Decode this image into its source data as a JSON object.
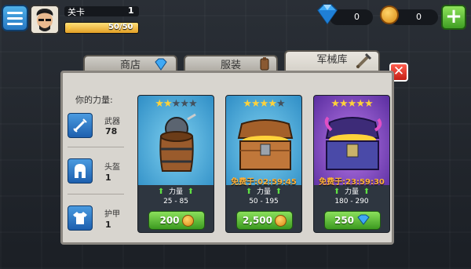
{
  "header": {
    "level_label": "关卡",
    "level_value": "1",
    "xp_text": "50/50",
    "xp_fraction": 1.0,
    "gems": "0",
    "coins": "0"
  },
  "tabs": [
    {
      "label": "商店",
      "icon": "diamond-icon"
    },
    {
      "label": "服装",
      "icon": "armor-icon"
    },
    {
      "label": "军械库",
      "icon": "sword-icon",
      "active": true
    }
  ],
  "stats": {
    "title": "你的力量:",
    "items": [
      {
        "label": "武器",
        "value": "78",
        "icon": "sword-icon"
      },
      {
        "label": "头盔",
        "value": "1",
        "icon": "helmet-icon"
      },
      {
        "label": "护甲",
        "value": "1",
        "icon": "armor-icon"
      }
    ]
  },
  "cards": [
    {
      "stars_on": 2,
      "stars_total": 5,
      "timer": "",
      "power_label": "力量",
      "range": "25 - 85",
      "price": "200",
      "currency": "coin",
      "item": "barrel"
    },
    {
      "stars_on": 4,
      "stars_total": 5,
      "timer": "免费于:02:59:45",
      "power_label": "力量",
      "range": "50 - 195",
      "price": "2,500",
      "currency": "coin",
      "item": "chest"
    },
    {
      "stars_on": 5,
      "stars_total": 5,
      "timer": "免费于:23:59:30",
      "power_label": "力量",
      "range": "180 - 290",
      "price": "250",
      "currency": "gem",
      "item": "purple-chest"
    }
  ],
  "colors": {
    "accent_green": "#3c9a20",
    "card_blue": "#2f8ec6",
    "card_purple": "#5a2ea0",
    "timer_orange": "#ffb23a"
  }
}
